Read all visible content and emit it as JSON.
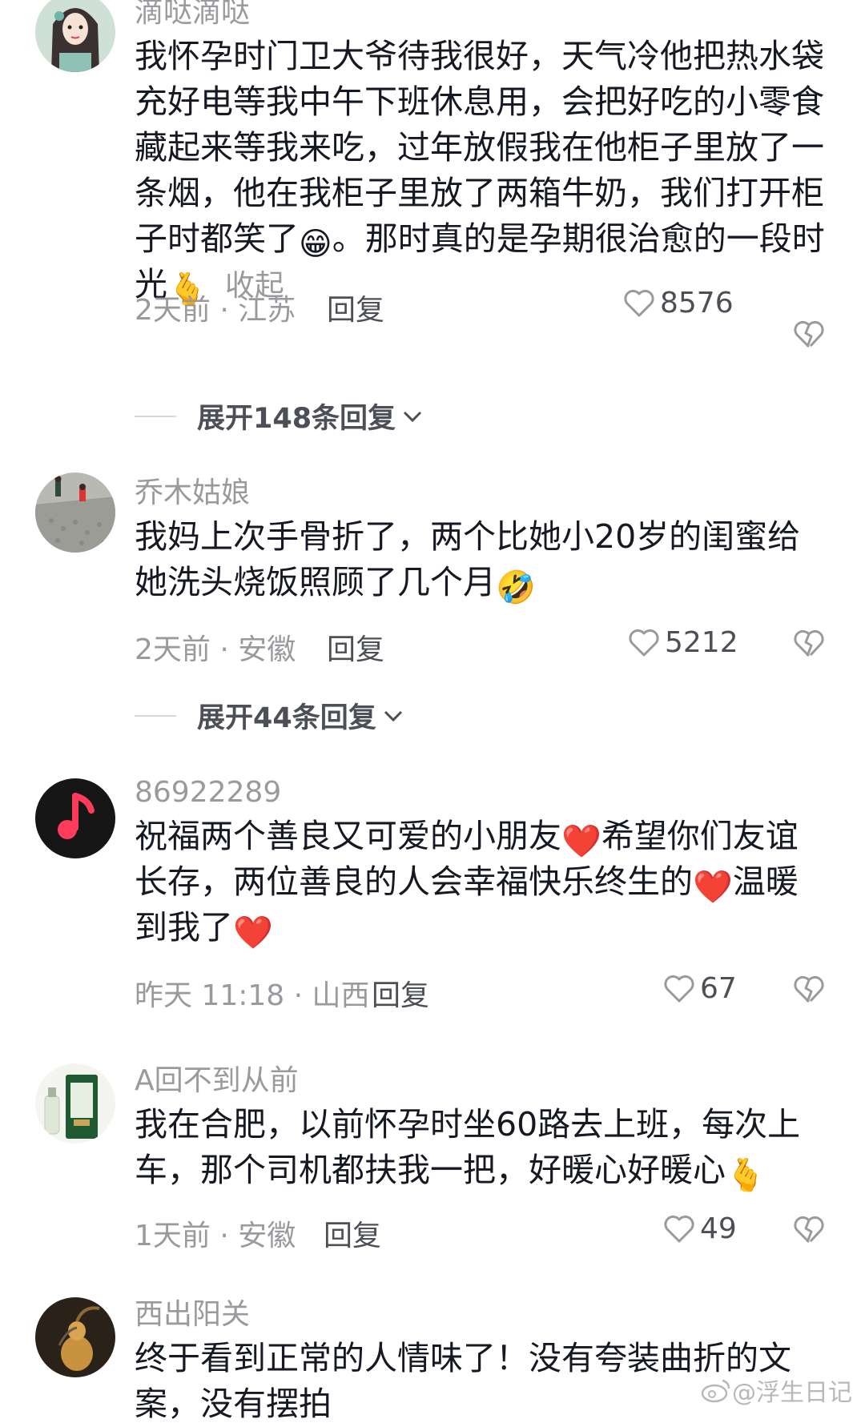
{
  "comments": [
    {
      "username": "滴哒滴哒",
      "text_a": "我怀孕时门卫大爷待我很好，天气冷他把热水袋充好电等我中午下班休息用，会把好吃的小零食藏起来等我来吃，过年放假我在他柜子里放了一条烟，他在我柜子里放了两箱牛奶，我们打开柜子时都笑了",
      "emoji_1": "😁",
      "text_b": "。那时真的是孕期很治愈的一段时光",
      "emoji_2": "🫰",
      "collapse_label": "收起",
      "time_location": "2天前 · 江苏",
      "reply_label": "回复",
      "likes": "8576",
      "expand_label": "展开148条回复"
    },
    {
      "username": "乔木姑娘",
      "text_a": "我妈上次手骨折了，两个比她小20岁的闺蜜给她洗头烧饭照顾了几个月",
      "emoji_1": "🤣",
      "time_location": "2天前 · 安徽",
      "reply_label": "回复",
      "likes": "5212",
      "expand_label": "展开44条回复"
    },
    {
      "username": "86922289",
      "text_a": "祝福两个善良又可爱的小朋友",
      "emoji_1": "❤️",
      "text_b": "希望你们友谊长存，两位善良的人会幸福快乐终生的",
      "emoji_2": "❤️",
      "text_c": "温暖到我了",
      "emoji_3": "❤️",
      "time_location": "昨天 11:18 · 山西",
      "reply_label": "回复",
      "likes": "67"
    },
    {
      "username": "A回不到从前",
      "text_a": "我在合肥，以前怀孕时坐60路去上班，每次上车，那个司机都扶我一把，好暖心好暖心",
      "emoji_1": "🫰",
      "time_location": "1天前 · 安徽",
      "reply_label": "回复",
      "likes": "49"
    },
    {
      "username": "西出阳关",
      "text_a": "终于看到正常的人情味了！没有夸装曲折的文案，没有摆拍"
    }
  ],
  "watermark": "@浮生日记",
  "colors": {
    "text_primary": "#161823",
    "text_secondary": "#9a9a9e",
    "text_action": "#4d4f57",
    "divider": "#d8d8da",
    "heart": "#ff2b54"
  }
}
